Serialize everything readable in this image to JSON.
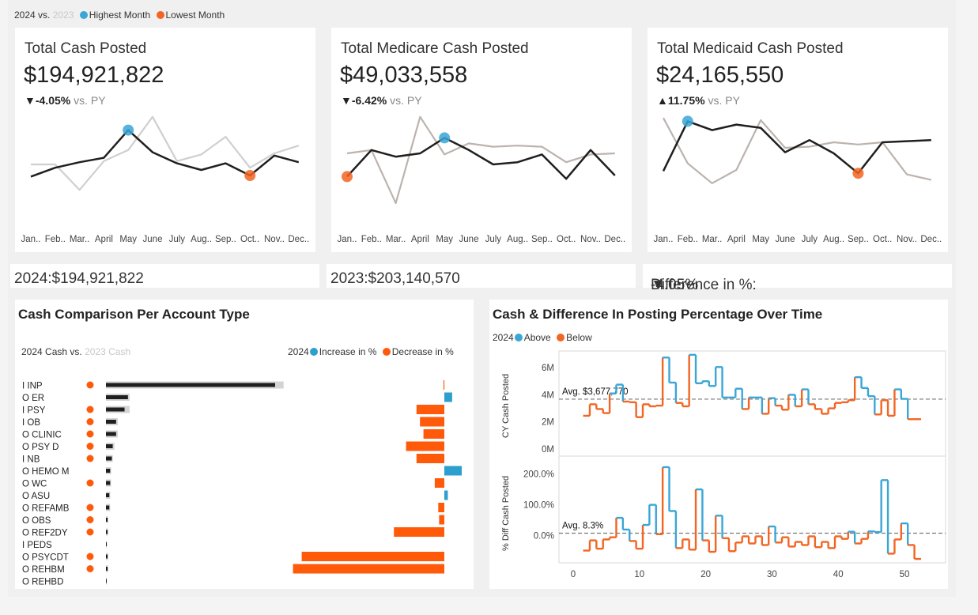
{
  "top_legend": {
    "current": "2024",
    "vs": "vs.",
    "prior": "2023",
    "highest": "Highest Month",
    "lowest": "Lowest Month"
  },
  "colors": {
    "blue": "#3aa6d6",
    "orange": "#f26522",
    "dark": "#1f1f1f",
    "grey": "#cfcfcf",
    "taupe": "#bcb3ae",
    "bar_orange": "#ff5a0a",
    "bar_blue": "#2c9fce"
  },
  "months": [
    "Jan..",
    "Feb..",
    "Mar..",
    "April",
    "May",
    "June",
    "July",
    "Aug..",
    "Sep..",
    "Oct..",
    "Nov..",
    "Dec.."
  ],
  "kpis": [
    {
      "title": "Total Cash Posted",
      "value": "$194,921,822",
      "arrow": "▼",
      "delta": "-4.05%",
      "vs": "vs. PY"
    },
    {
      "title": "Total Medicare Cash Posted",
      "value": "$49,033,558",
      "arrow": "▼",
      "delta": "-6.42%",
      "vs": "vs. PY"
    },
    {
      "title": "Total Medicaid Cash Posted",
      "value": "$24,165,550",
      "arrow": "▲",
      "delta": "11.75%",
      "vs": "vs. PY"
    }
  ],
  "summary": {
    "y2024": "2024:$194,921,822",
    "y2023": "2023:$203,140,570",
    "diff_label": "Difference in %:",
    "diff_arrow": "▼",
    "diff_value": "-4.05%"
  },
  "account_panel": {
    "title": "Cash Comparison Per Account Type",
    "legend_left_cur": "2024 Cash",
    "legend_left_vs": "vs.",
    "legend_left_prior": "2023 Cash",
    "legend_right_year": "2024",
    "increase": "Increase in %",
    "decrease": "Decrease in %"
  },
  "time_panel": {
    "title": "Cash & Difference In Posting Percentage Over Time",
    "legend_year": "2024",
    "above": "Above",
    "below": "Below",
    "ylabel_top": "CY Cash Posted",
    "ylabel_bottom": "% Diff Cash Posted",
    "avg_top": "Avg. $3,677,770",
    "avg_bottom": "Avg. 8.3%"
  },
  "chart_data": [
    {
      "type": "line",
      "title": "Total Cash Posted",
      "x": [
        "Jan..",
        "Feb..",
        "Mar..",
        "April",
        "May",
        "June",
        "July",
        "Aug..",
        "Sep..",
        "Oct..",
        "Nov..",
        "Dec.."
      ],
      "ylim": [
        0,
        100
      ],
      "series": [
        {
          "name": "2024",
          "values": [
            44,
            52,
            57,
            61,
            86,
            66,
            56,
            50,
            56,
            45,
            63,
            57
          ]
        },
        {
          "name": "2023",
          "values": [
            55,
            55,
            32,
            58,
            68,
            98,
            58,
            64,
            80,
            52,
            65,
            72
          ]
        }
      ],
      "highest_index": 4,
      "lowest_index": 9
    },
    {
      "type": "line",
      "title": "Total Medicare Cash Posted",
      "x": [
        "Jan..",
        "Feb..",
        "Mar..",
        "April",
        "May",
        "June",
        "July",
        "Aug..",
        "Sep..",
        "Oct..",
        "Nov..",
        "Dec.."
      ],
      "ylim": [
        0,
        100
      ],
      "series": [
        {
          "name": "2024",
          "values": [
            44,
            68,
            62,
            65,
            79,
            68,
            55,
            57,
            64,
            42,
            68,
            45
          ]
        },
        {
          "name": "2023",
          "values": [
            65,
            68,
            20,
            98,
            64,
            74,
            71,
            72,
            71,
            57,
            64,
            65
          ]
        }
      ],
      "highest_index": 4,
      "lowest_index": 0
    },
    {
      "type": "line",
      "title": "Total Medicaid Cash Posted",
      "x": [
        "Jan..",
        "Feb..",
        "Mar..",
        "April",
        "May",
        "June",
        "July",
        "Aug..",
        "Sep..",
        "Oct..",
        "Nov..",
        "Dec.."
      ],
      "ylim": [
        0,
        100
      ],
      "series": [
        {
          "name": "2024",
          "values": [
            49,
            94,
            86,
            91,
            88,
            66,
            77,
            65,
            47,
            75,
            76,
            77
          ]
        },
        {
          "name": "2023",
          "values": [
            97,
            56,
            38,
            50,
            95,
            70,
            71,
            75,
            73,
            75,
            46,
            41
          ]
        }
      ],
      "highest_index": 1,
      "lowest_index": 8
    },
    {
      "type": "bar",
      "title": "Cash Comparison Per Account Type",
      "categories": [
        "I INP",
        "O ER",
        "I PSY",
        "I OB",
        "O CLINIC",
        "O PSY D",
        "I NB",
        "O HEMO M",
        "O WC",
        "O ASU",
        "O REFAMB",
        "O OBS",
        "O REF2DY",
        "I PEDS",
        "O PSYCDT",
        "O REHBM",
        "O REHBD"
      ],
      "series": [
        {
          "name": "2024 Cash",
          "values": [
            100,
            13,
            11,
            6,
            6,
            4,
            3.5,
            2.5,
            2.5,
            2,
            2,
            1,
            1,
            0.5,
            1,
            1,
            0.4
          ]
        },
        {
          "name": "2023 Cash",
          "values": [
            105,
            14,
            14,
            7,
            7,
            5,
            4,
            3,
            3,
            2.5,
            2.5,
            1.2,
            1.2,
            0.5,
            1.2,
            1.2,
            0.5
          ]
        },
        {
          "name": "Difference in %",
          "values": [
            -0.5,
            4.5,
            -16,
            -14,
            -12,
            -22,
            -16,
            10,
            -5.5,
            2,
            -3.5,
            -3,
            -29,
            0,
            -82,
            -87,
            0
          ]
        }
      ],
      "decrease_flag": [
        true,
        false,
        true,
        true,
        true,
        true,
        true,
        false,
        true,
        false,
        true,
        true,
        true,
        false,
        true,
        true,
        false
      ]
    },
    {
      "type": "line",
      "title": "Cash & Difference In Posting Percentage Over Time",
      "ylabel": "CY Cash Posted",
      "ylim": [
        0,
        7000000
      ],
      "yticks": [
        "0M",
        "2M",
        "4M",
        "6M"
      ],
      "average": 3677770,
      "x": [
        2,
        3,
        4,
        5,
        6,
        7,
        8,
        9,
        10,
        11,
        12,
        13,
        14,
        15,
        16,
        17,
        18,
        19,
        20,
        21,
        22,
        23,
        24,
        25,
        26,
        27,
        28,
        29,
        30,
        31,
        32,
        33,
        34,
        35,
        36,
        37,
        38,
        39,
        40,
        41,
        42,
        43,
        44,
        45,
        46,
        47,
        48,
        49,
        50,
        51,
        52
      ],
      "values": [
        2450000,
        3300000,
        2950000,
        2650000,
        4100000,
        4750000,
        3500000,
        3450000,
        2350000,
        3300000,
        3150000,
        3200000,
        6750000,
        4900000,
        3400000,
        3150000,
        6950000,
        4850000,
        5000000,
        4650000,
        6050000,
        3800000,
        3800000,
        4450000,
        2950000,
        3800000,
        3800000,
        2600000,
        3750000,
        3200000,
        2900000,
        4000000,
        3150000,
        4400000,
        3300000,
        2950000,
        2600000,
        3000000,
        3400000,
        3450000,
        3600000,
        5300000,
        4500000,
        3900000,
        2550000,
        3600000,
        2450000,
        4400000,
        3700000,
        2200000,
        2200000
      ],
      "xticks": [
        0,
        10,
        20,
        30,
        40,
        50
      ]
    },
    {
      "type": "line",
      "title": "Cash & Difference In Posting Percentage Over Time",
      "ylabel": "% Diff Cash Posted",
      "ylim": [
        -80,
        250
      ],
      "yticks": [
        "0.0%",
        "100.0%",
        "200.0%"
      ],
      "average": 8.3,
      "x": [
        2,
        3,
        4,
        5,
        6,
        7,
        8,
        9,
        10,
        11,
        12,
        13,
        14,
        15,
        16,
        17,
        18,
        19,
        20,
        21,
        22,
        23,
        24,
        25,
        26,
        27,
        28,
        29,
        30,
        31,
        32,
        33,
        34,
        35,
        36,
        37,
        38,
        39,
        40,
        41,
        42,
        43,
        44,
        45,
        46,
        47,
        48,
        49,
        50,
        51,
        52
      ],
      "values": [
        -48,
        -15,
        -42,
        -12,
        -5,
        58,
        20,
        -17,
        -42,
        35,
        100,
        5,
        222,
        80,
        -40,
        -12,
        -45,
        150,
        -15,
        -52,
        65,
        -8,
        -50,
        -22,
        -2,
        -25,
        -2,
        -30,
        30,
        -22,
        -5,
        -35,
        -20,
        -30,
        -2,
        -37,
        -20,
        -40,
        -2,
        -10,
        13,
        -25,
        -10,
        14,
        12,
        180,
        -58,
        -12,
        40,
        -30,
        -75
      ],
      "xticks": [
        0,
        10,
        20,
        30,
        40,
        50
      ]
    }
  ]
}
